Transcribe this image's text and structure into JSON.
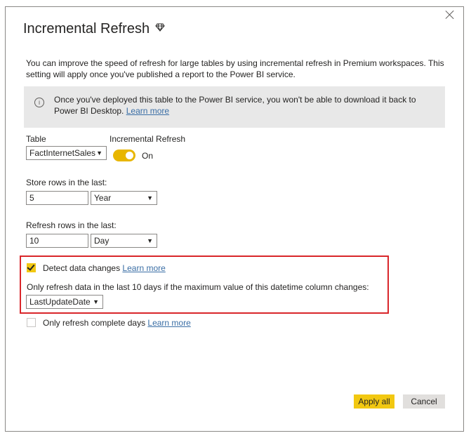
{
  "dialog": {
    "title": "Incremental Refresh",
    "premium_icon": "diamond-icon",
    "close_icon": "close-icon",
    "description": "You can improve the speed of refresh for large tables by using incremental refresh in Premium workspaces. This setting will apply once you've published a report to the Power BI service.",
    "info": {
      "icon": "info-icon",
      "text": "Once you've deployed this table to the Power BI service, you won't be able to download it back to Power BI Desktop.",
      "link": "Learn more"
    }
  },
  "table": {
    "label": "Table",
    "value": "FactInternetSales"
  },
  "incremental_refresh": {
    "label": "Incremental Refresh",
    "state_label": "On",
    "enabled": true
  },
  "store_rows": {
    "label": "Store rows in the last:",
    "value": "5",
    "unit": "Year"
  },
  "refresh_rows": {
    "label": "Refresh rows in the last:",
    "value": "10",
    "unit": "Day"
  },
  "detect_changes": {
    "checked": true,
    "label": "Detect data changes",
    "link": "Learn more",
    "description": "Only refresh data in the last 10 days if the maximum value of this datetime column changes:",
    "column": "LastUpdateDate"
  },
  "complete_days": {
    "checked": false,
    "label": "Only refresh complete days",
    "link": "Learn more"
  },
  "buttons": {
    "apply_all": "Apply all",
    "cancel": "Cancel"
  },
  "colors": {
    "accent": "#f2c811",
    "highlight_border": "#d9262a",
    "link": "#3a6ea5",
    "info_bg": "#e8e8e8"
  }
}
